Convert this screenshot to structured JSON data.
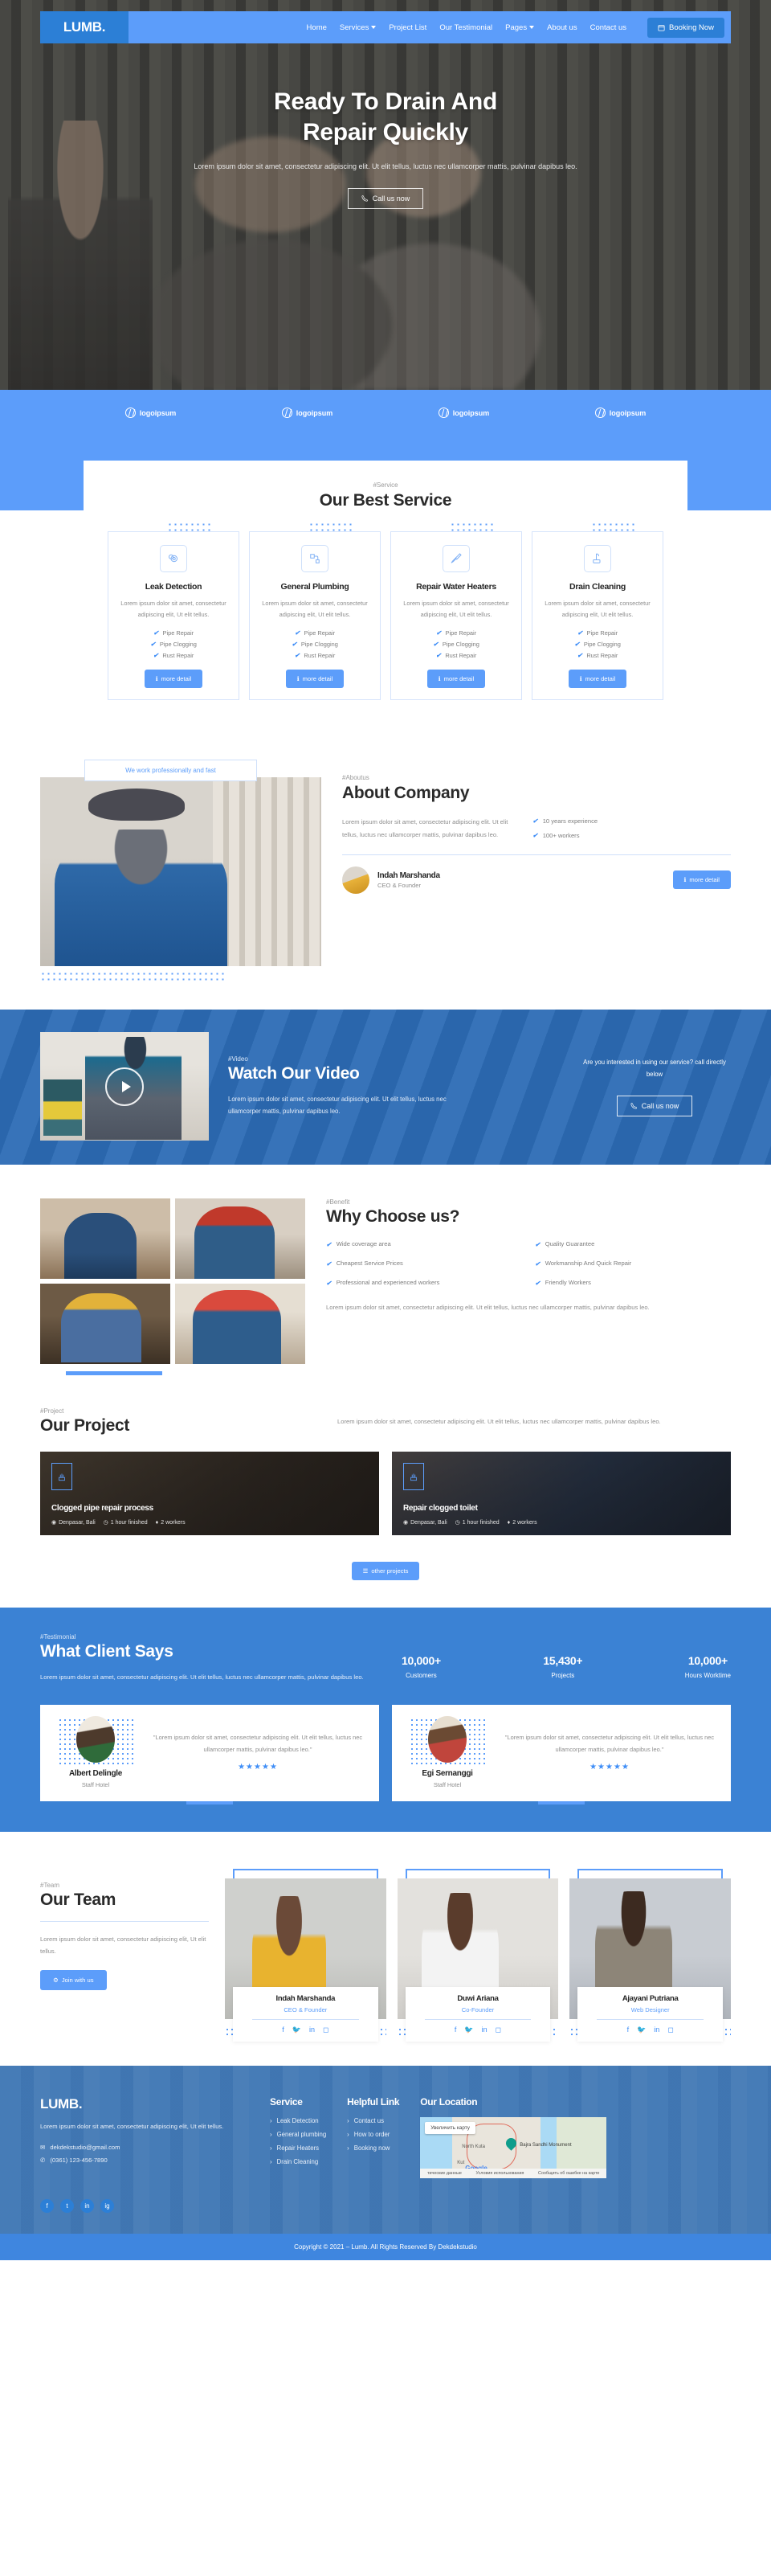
{
  "brand": {
    "name": "LUMB."
  },
  "nav": {
    "items": [
      {
        "label": "Home",
        "caret": false
      },
      {
        "label": "Services",
        "caret": true
      },
      {
        "label": "Project List",
        "caret": false
      },
      {
        "label": "Our Testimonial",
        "caret": false
      },
      {
        "label": "Pages",
        "caret": true
      },
      {
        "label": "About us",
        "caret": false
      },
      {
        "label": "Contact us",
        "caret": false
      }
    ],
    "booking_label": "Booking Now",
    "booking_icon": "calendar-icon"
  },
  "hero": {
    "title_line1": "Ready To Drain And",
    "title_line2": "Repair Quickly",
    "paragraph": "Lorem ipsum dolor sit amet, consectetur adipiscing elit. Ut elit tellus, luctus nec ullamcorper mattis, pulvinar dapibus leo.",
    "cta_label": "Call us now",
    "cta_icon": "phone-icon"
  },
  "logos": [
    {
      "label": "logoipsum"
    },
    {
      "label": "logoipsum"
    },
    {
      "label": "logoipsum"
    },
    {
      "label": "logoipsum"
    }
  ],
  "service": {
    "tag": "#Service",
    "title": "Our Best Service",
    "cards": [
      {
        "icon": "leak-detection-icon",
        "title": "Leak Detection",
        "desc": "Lorem ipsum dolor sit amet, consectetur adipiscing elit, Ut elit tellus.",
        "features": [
          "Pipe Repair",
          "Pipe Clogging",
          "Rust Repair"
        ],
        "button": "more detail"
      },
      {
        "icon": "pipe-icon",
        "title": "General Plumbing",
        "desc": "Lorem ipsum dolor sit amet, consectetur adipiscing elit, Ut elit tellus.",
        "features": [
          "Pipe Repair",
          "Pipe Clogging",
          "Rust Repair"
        ],
        "button": "more detail"
      },
      {
        "icon": "screwdriver-icon",
        "title": "Repair Water Heaters",
        "desc": "Lorem ipsum dolor sit amet, consectetur adipiscing elit, Ut elit tellus.",
        "features": [
          "Pipe Repair",
          "Pipe Clogging",
          "Rust Repair"
        ],
        "button": "more detail"
      },
      {
        "icon": "drain-cleaning-icon",
        "title": "Drain Cleaning",
        "desc": "Lorem ipsum dolor sit amet, consectetur adipiscing elit, Ut elit tellus.",
        "features": [
          "Pipe Repair",
          "Pipe Clogging",
          "Rust Repair"
        ],
        "button": "more detail"
      }
    ]
  },
  "about": {
    "pill": "We work professionally and fast",
    "tag": "#Aboutus",
    "title": "About Company",
    "paragraph": "Lorem ipsum dolor sit amet, consectetur adipiscing elit. Ut elit tellus, luctus nec ullamcorper mattis, pulvinar dapibus leo.",
    "features": [
      "10 years experience",
      "100+ workers"
    ],
    "person_name": "Indah Marshanda",
    "person_role": "CEO & Founder",
    "button": "more detail"
  },
  "video": {
    "tag": "#Video",
    "title": "Watch Our Video",
    "paragraph": "Lorem ipsum dolor sit amet, consectetur adipiscing elit. Ut elit tellus, luctus nec ullamcorper mattis, pulvinar dapibus leo.",
    "right_text": "Are you interested in using our service? call directly below",
    "cta_label": "Call us now",
    "play_icon": "play-icon"
  },
  "benefit": {
    "tag": "#Benefit",
    "title": "Why Choose us?",
    "list_left": [
      "Wide coverage area",
      "Cheapest Service Prices",
      "Professional and experienced workers"
    ],
    "list_right": [
      "Quality Guarantee",
      "Workmanship And Quick Repair",
      "Friendly Workers"
    ],
    "paragraph": "Lorem ipsum dolor sit amet, consectetur adipiscing elit. Ut elit tellus, luctus nec ullamcorper mattis, pulvinar dapibus leo."
  },
  "project": {
    "tag": "#Project",
    "title": "Our Project",
    "paragraph": "Lorem ipsum dolor sit amet, consectetur adipiscing elit. Ut elit tellus, luctus nec ullamcorper mattis, pulvinar dapibus leo.",
    "cards": [
      {
        "title": "Clogged pipe repair process",
        "location": "Denpasar, Bali",
        "duration": "1 hour finished",
        "workers": "2 workers"
      },
      {
        "title": "Repair clogged toilet",
        "location": "Denpasar, Bali",
        "duration": "1 hour finished",
        "workers": "2 workers"
      }
    ],
    "button": "other projects"
  },
  "testimonial": {
    "tag": "#Testimonial",
    "title": "What Client Says",
    "paragraph": "Lorem ipsum dolor sit amet, consectetur adipiscing elit. Ut elit tellus, luctus nec ullamcorper mattis, pulvinar dapibus leo.",
    "stats": [
      {
        "num": "10,000+",
        "label": "Customers"
      },
      {
        "num": "15,430+",
        "label": "Projects"
      },
      {
        "num": "10,000+",
        "label": "Hours Worktime"
      }
    ],
    "cards": [
      {
        "name": "Albert Delingle",
        "role": "Staff Hotel",
        "quote": "\"Lorem ipsum dolor sit amet, consectetur adipiscing elit. Ut elit tellus, luctus nec ullamcorper mattis, pulvinar dapibus leo.\"",
        "stars": "★★★★★"
      },
      {
        "name": "Egi Sernanggi",
        "role": "Staff Hotel",
        "quote": "\"Lorem ipsum dolor sit amet, consectetur adipiscing elit. Ut elit tellus, luctus nec ullamcorper mattis, pulvinar dapibus leo.\"",
        "stars": "★★★★★"
      }
    ]
  },
  "team": {
    "tag": "#Team",
    "title": "Our Team",
    "paragraph": "Lorem ipsum dolor sit amet, consectetur adipiscing elit, Ut elit tellus.",
    "button": "Join with us",
    "members": [
      {
        "name": "Indah Marshanda",
        "role": "CEO & Founder"
      },
      {
        "name": "Duwi Ariana",
        "role": "Co-Founder"
      },
      {
        "name": "Ajayani Putriana",
        "role": "Web Designer"
      }
    ],
    "socials": [
      "facebook-icon",
      "twitter-icon",
      "linkedin-icon",
      "instagram-icon"
    ]
  },
  "footer": {
    "brand": "LUMB.",
    "about": "Lorem ipsum dolor sit amet, consectetur adipiscing elit, Ut elit tellus.",
    "email": "dekdekstudio@gmail.com",
    "phone": "(0361) 123-456-7890",
    "service_title": "Service",
    "service_links": [
      "Leak Detection",
      "General plumbing",
      "Repair Heaters",
      "Drain Cleaning"
    ],
    "helpful_title": "Helpful Link",
    "helpful_links": [
      "Contact us",
      "How to order",
      "Booking now"
    ],
    "location_title": "Our Location",
    "map": {
      "zoom_label": "Увеличить карту",
      "label_kuta": "North Kuta",
      "label_monument": "Bajra Sandhi Monument",
      "label_kut": "Kut",
      "brand": "Google",
      "bar": [
        "тические данные",
        "Условия использования",
        "Сообщить об ошибке на карте"
      ]
    },
    "socials": [
      "f",
      "t",
      "in",
      "ig"
    ],
    "copyright": "Copyright © 2021 – Lumb. All Rights Reserved By Dekdekstudio"
  }
}
